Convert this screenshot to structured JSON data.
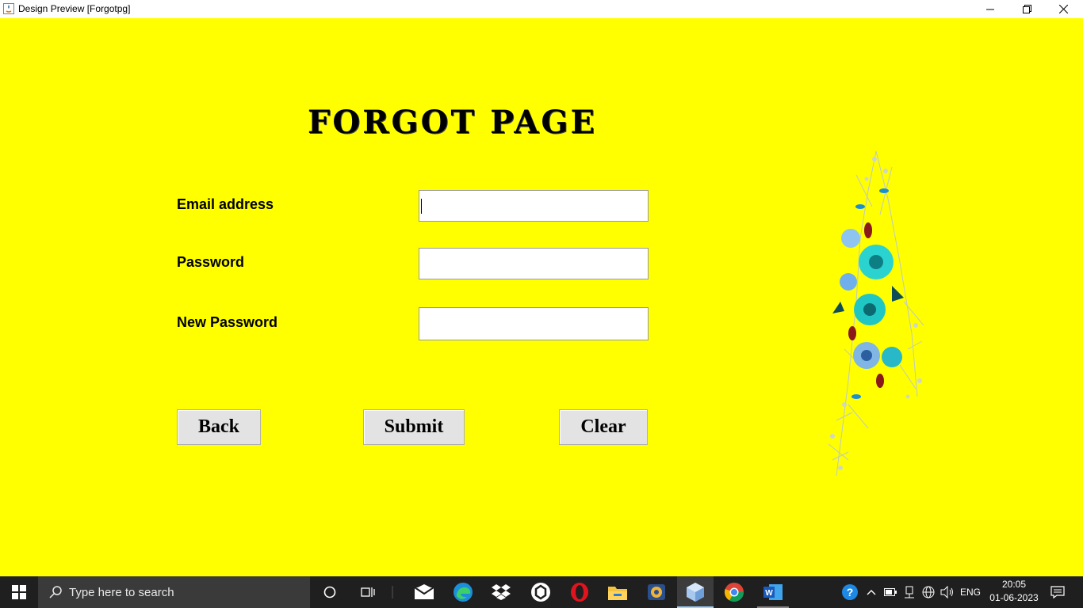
{
  "window": {
    "title": "Design Preview [Forgotpg]"
  },
  "form": {
    "heading": "FORGOT PAGE",
    "email_label": "Email address",
    "email_value": "",
    "password_label": "Password",
    "password_value": "",
    "new_password_label": "New Password",
    "new_password_value": "",
    "back_label": "Back",
    "submit_label": "Submit",
    "clear_label": "Clear"
  },
  "taskbar": {
    "search_placeholder": "Type here to search",
    "language": "ENG",
    "time": "20:05",
    "date": "01-06-2023",
    "icons": [
      "windows-start-icon",
      "search-icon",
      "cortana-icon",
      "task-view-icon",
      "mail-icon",
      "edge-icon",
      "dropbox-icon",
      "app-hex-icon",
      "opera-icon",
      "file-explorer-icon",
      "media-icon",
      "java-app-icon",
      "chrome-icon",
      "word-icon",
      "help-icon",
      "chevron-up-icon",
      "battery-icon",
      "network-icon",
      "globe-icon",
      "volume-icon",
      "notification-icon"
    ]
  },
  "colors": {
    "background": "#ffff00",
    "taskbar": "#1f1f1f",
    "button": "#e3e3e3"
  }
}
